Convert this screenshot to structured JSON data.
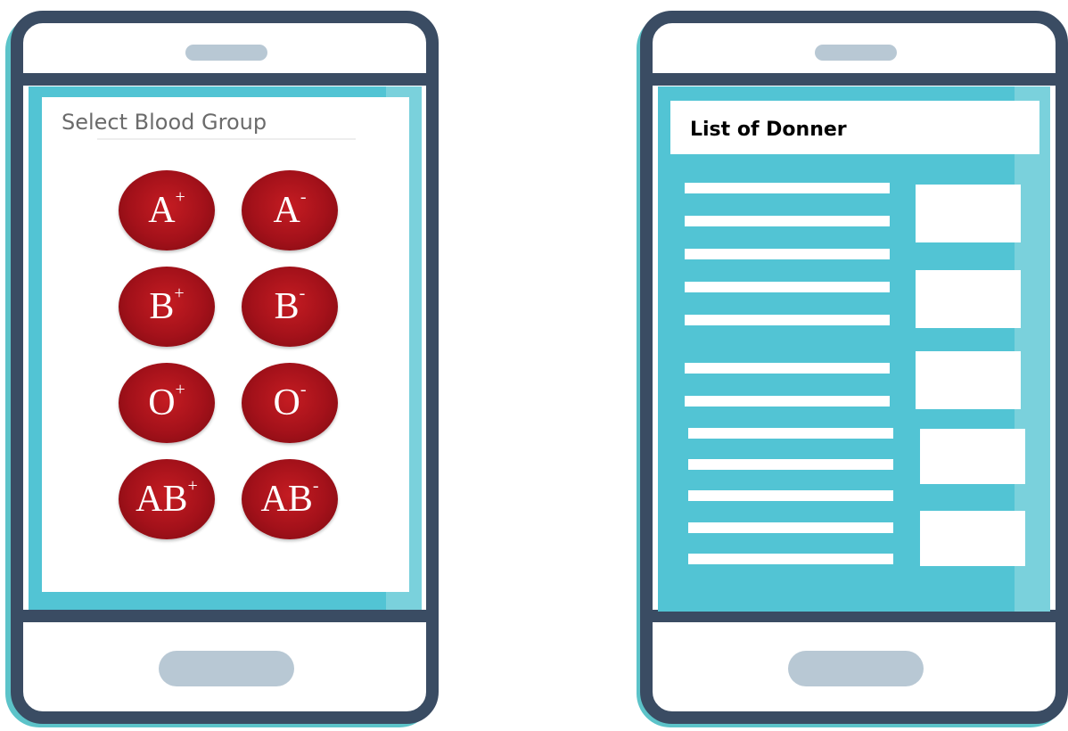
{
  "selection_screen": {
    "title": "Select Blood Group",
    "blood_groups": [
      {
        "letter": "A",
        "sign": "+"
      },
      {
        "letter": "A",
        "sign": "-"
      },
      {
        "letter": "B",
        "sign": "+"
      },
      {
        "letter": "B",
        "sign": "-"
      },
      {
        "letter": "O",
        "sign": "+"
      },
      {
        "letter": "O",
        "sign": "-"
      },
      {
        "letter": "AB",
        "sign": "+"
      },
      {
        "letter": "AB",
        "sign": "-"
      }
    ]
  },
  "donor_screen": {
    "title": "List of Donner"
  },
  "colors": {
    "phone_frame": "#3a4c63",
    "screen": "#52c4d4",
    "blood": "#a3111a"
  }
}
